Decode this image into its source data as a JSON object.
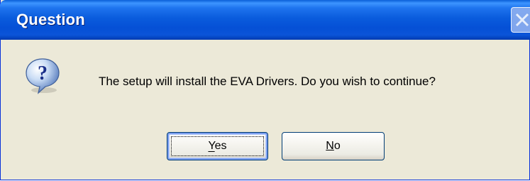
{
  "window": {
    "title": "Question",
    "close_icon": "close-icon"
  },
  "dialog": {
    "icon": "question-icon",
    "message": "The setup will install the EVA Drivers. Do you wish to continue?",
    "buttons": {
      "yes": {
        "label": "Yes",
        "mnemonic": "Y"
      },
      "no": {
        "label": "No",
        "mnemonic": "N"
      }
    }
  },
  "colors": {
    "titlebar": "#0a5cdd",
    "dialog_bg": "#ece9d8",
    "button_border": "#003c74"
  }
}
